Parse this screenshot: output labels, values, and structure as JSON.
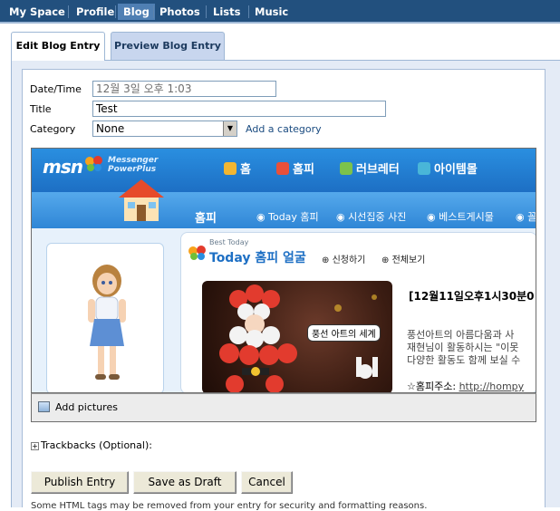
{
  "nav": {
    "items": [
      "My Space",
      "Profile",
      "Blog",
      "Photos",
      "Lists",
      "Music"
    ],
    "active": "Blog"
  },
  "tabs": {
    "edit": "Edit Blog Entry",
    "preview": "Preview Blog Entry"
  },
  "form": {
    "date_label": "Date/Time",
    "date_value": "12월 3일 오후 1:03",
    "title_label": "Title",
    "title_value": "Test",
    "category_label": "Category",
    "category_value": "None",
    "add_category": "Add a category"
  },
  "embedded": {
    "logo": "msn",
    "logo_sub": "Messenger PowerPlus",
    "menu": [
      "홈",
      "홈피",
      "러브레터",
      "아이템몰"
    ],
    "section_title": "홈피",
    "sub_links": [
      "Today 홈피",
      "시선집중 사진",
      "베스트게시물",
      "꼴"
    ],
    "best_today": "Best Today",
    "today_title": "Today 홈피 얼굴",
    "today_links": [
      "신청하기",
      "전체보기"
    ],
    "photo_caption": "풍선 아트의 세계",
    "news_title": "[12월11일오후1시30분0",
    "news_lines": [
      "풍선아트의 아름다움과 사",
      "재현님이 활동하시는 \"이못",
      "다양한 활동도 함께 보실 수"
    ],
    "url_label": "☆홈피주소:",
    "url_value": "http://hompy"
  },
  "editor": {
    "add_pictures": "Add pictures"
  },
  "trackbacks": "Trackbacks (Optional):",
  "buttons": {
    "publish": "Publish Entry",
    "draft": "Save as Draft",
    "cancel": "Cancel"
  },
  "disclaimer": "Some HTML tags may be removed from your entry for security and formatting reasons.",
  "colors": {
    "nav_bg": "#22507e",
    "nav_active": "#4f7fb3",
    "panel_bg": "#e4ebf6",
    "msn_blue": "#1d6fc4"
  }
}
